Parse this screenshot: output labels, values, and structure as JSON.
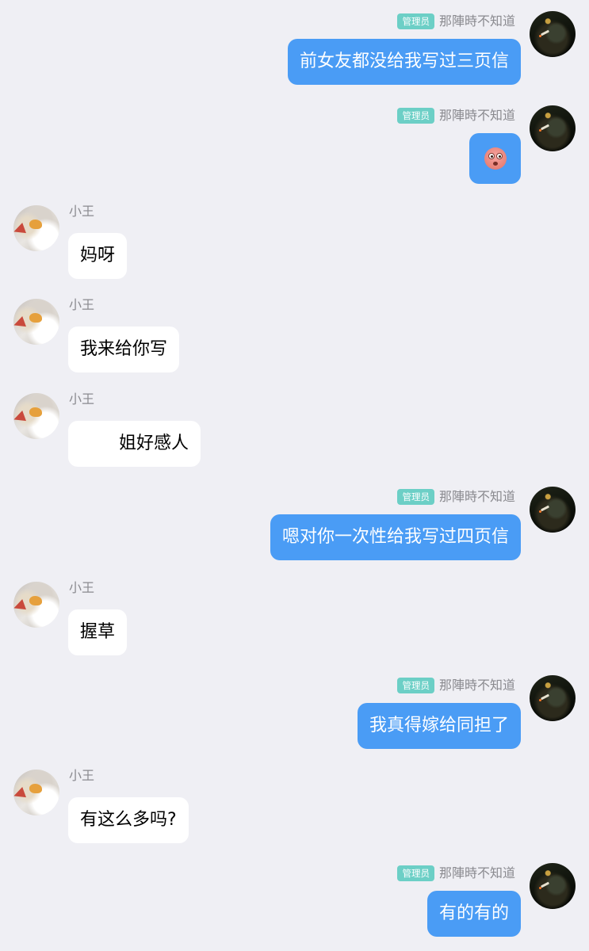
{
  "admin": {
    "badge": "管理员",
    "nickname": "那陣時不知道"
  },
  "other": {
    "nickname": "小王"
  },
  "messages": [
    {
      "side": "right",
      "text": "前女友都没给我写过三页信"
    },
    {
      "side": "right",
      "emoji": "flushed-face"
    },
    {
      "side": "left",
      "text": "妈呀"
    },
    {
      "side": "left",
      "text": "我来给你写"
    },
    {
      "side": "left",
      "text": "姐好感人"
    },
    {
      "side": "right",
      "text": "嗯对你一次性给我写过四页信"
    },
    {
      "side": "left",
      "text": "握草"
    },
    {
      "side": "right",
      "text": "我真得嫁给同担了"
    },
    {
      "side": "left",
      "text": "有这么多吗?"
    },
    {
      "side": "right",
      "text": "有的有的"
    }
  ],
  "colors": {
    "background": "#efeff4",
    "outgoing_bubble": "#4a9cf5",
    "incoming_bubble": "#ffffff",
    "admin_badge": "#6ccfc6",
    "nickname": "#8a8a8f"
  }
}
